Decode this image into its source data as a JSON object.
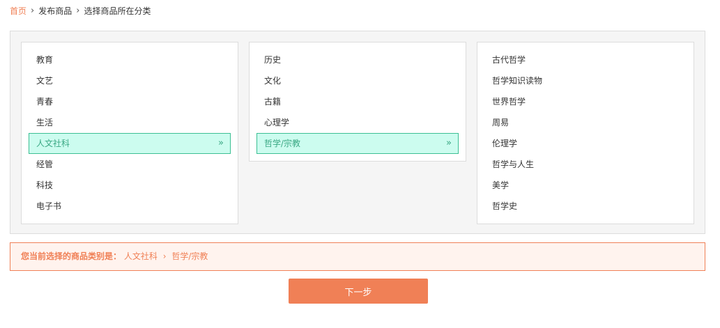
{
  "breadcrumb": {
    "home": "首页",
    "items": [
      "发布商品",
      "选择商品所在分类"
    ]
  },
  "columns": {
    "level1": [
      "教育",
      "文艺",
      "青春",
      "生活",
      "人文社科",
      "经管",
      "科技",
      "电子书"
    ],
    "level2": [
      "历史",
      "文化",
      "古籍",
      "心理学",
      "哲学/宗教"
    ],
    "level3": [
      "古代哲学",
      "哲学知识读物",
      "世界哲学",
      "周易",
      "伦理学",
      "哲学与人生",
      "美学",
      "哲学史"
    ]
  },
  "selected": {
    "level1": "人文社科",
    "level2": "哲学/宗教"
  },
  "selection_bar": {
    "label": "您当前选择的商品类别是：",
    "path": [
      "人文社科",
      "哲学/宗教"
    ]
  },
  "next_button": "下一步",
  "colors": {
    "accent": "#f08056",
    "selected_bg": "#ccfcef",
    "selected_border": "#3bbf93"
  }
}
